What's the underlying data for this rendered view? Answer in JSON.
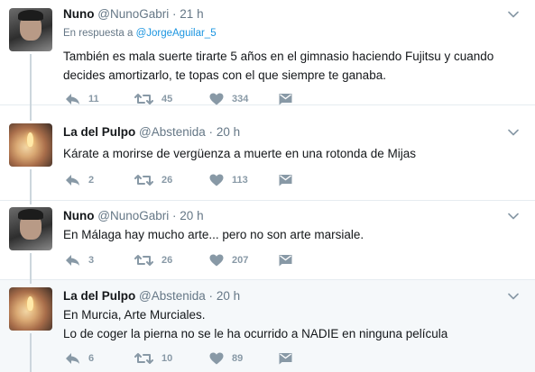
{
  "tweets": [
    {
      "name": "Nuno",
      "handle": "@NunoGabri",
      "dot": "·",
      "time": "21 h",
      "reply_prefix": "En respuesta a",
      "reply_mention": "@JorgeAguilar_5",
      "text": "También es mala suerte tirarte 5 años en el gimnasio haciendo Fujitsu y cuando decides amortizarlo, te topas con el que siempre te ganaba.",
      "replies": "11",
      "retweets": "45",
      "likes": "334"
    },
    {
      "name": "La del Pulpo",
      "handle": "@Abstenida",
      "dot": "·",
      "time": "20 h",
      "text": "Kárate a morirse de vergüenza a muerte en una rotonda de Mijas",
      "replies": "2",
      "retweets": "26",
      "likes": "113"
    },
    {
      "name": "Nuno",
      "handle": "@NunoGabri",
      "dot": "·",
      "time": "20 h",
      "text": "En Málaga hay mucho arte... pero no son arte marsiale.",
      "replies": "3",
      "retweets": "26",
      "likes": "207"
    },
    {
      "name": "La del Pulpo",
      "handle": "@Abstenida",
      "dot": "·",
      "time": "20 h",
      "text_line1": "En Murcia, Arte Murciales.",
      "text_line2": "Lo de coger la pierna no se le ha ocurrido a NADIE en ninguna película",
      "replies": "6",
      "retweets": "10",
      "likes": "89"
    }
  ],
  "colors": {
    "text": "#14171a",
    "muted": "#657786",
    "link": "#1b95e0",
    "icon": "#8899a6",
    "thread": "#ccd6dd",
    "highlight_bg": "#f5f8fa"
  },
  "icons": [
    "chevron-down-icon",
    "reply-icon",
    "retweet-icon",
    "heart-icon",
    "direct-message-icon"
  ]
}
